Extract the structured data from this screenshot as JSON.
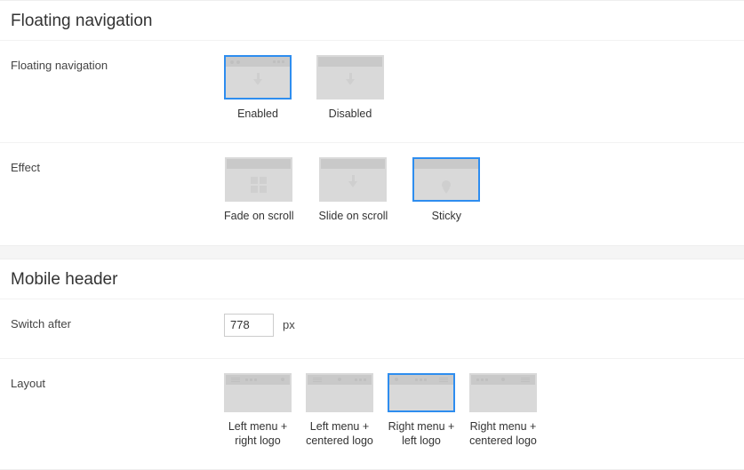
{
  "sections": {
    "floating_nav": {
      "title": "Floating navigation",
      "field_label": "Floating navigation",
      "options": {
        "enabled": "Enabled",
        "disabled": "Disabled"
      },
      "selected": "enabled"
    },
    "effect": {
      "field_label": "Effect",
      "options": {
        "fade": "Fade on scroll",
        "slide": "Slide on scroll",
        "sticky": "Sticky"
      },
      "selected": "sticky"
    },
    "mobile_header": {
      "title": "Mobile header",
      "switch_after": {
        "label": "Switch after",
        "value": "778",
        "unit": "px"
      },
      "layout": {
        "label": "Layout",
        "options": {
          "left_right": "Left menu +\nright logo",
          "left_center": "Left menu +\ncentered logo",
          "right_left": "Right menu +\nleft logo",
          "right_center": "Right menu +\ncentered logo"
        },
        "selected": "right_left"
      }
    }
  }
}
